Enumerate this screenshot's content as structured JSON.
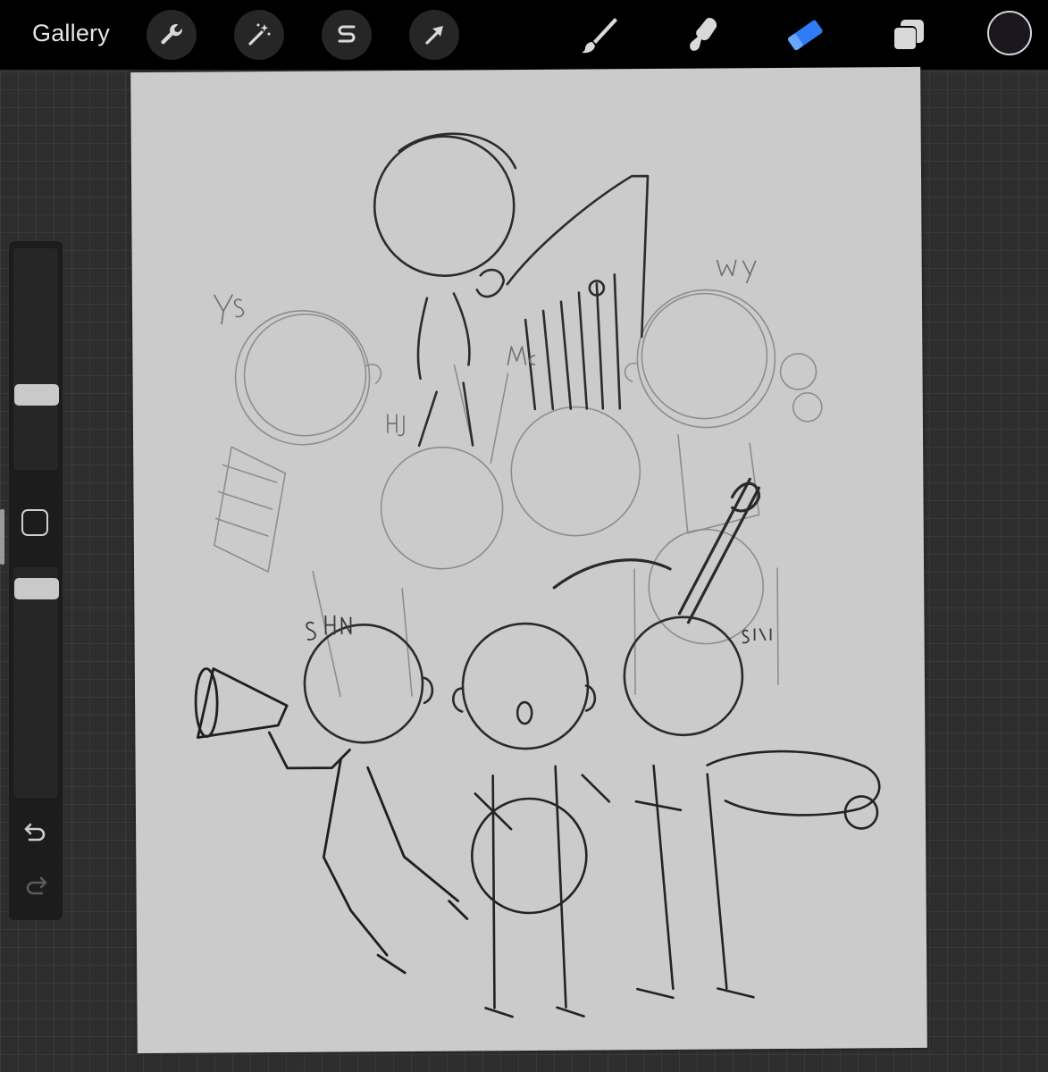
{
  "toolbar": {
    "gallery_label": "Gallery",
    "left_tools": [
      {
        "name": "actions",
        "icon": "wrench-icon"
      },
      {
        "name": "adjustments",
        "icon": "magic-wand-icon"
      },
      {
        "name": "selection",
        "icon": "selection-s-icon"
      },
      {
        "name": "transform",
        "icon": "arrow-cursor-icon"
      }
    ],
    "right_tools": [
      {
        "name": "brush",
        "icon": "brush-icon",
        "active": false
      },
      {
        "name": "smudge",
        "icon": "smudge-icon",
        "active": false
      },
      {
        "name": "eraser",
        "icon": "eraser-icon",
        "active": true
      },
      {
        "name": "layers",
        "icon": "layers-icon",
        "active": false
      }
    ],
    "current_color": "#1b1720",
    "active_tool_color": "#2f7df6"
  },
  "sidebar": {
    "brush_size_level": 0.7,
    "opacity_level": 0.85,
    "modify_button_icon": "square-icon",
    "undo_icon": "undo-icon",
    "redo_icon": "redo-icon"
  },
  "canvas": {
    "background": "#cbcbcb",
    "sketch_labels": [
      "YS",
      "WY",
      "HJ",
      "MG",
      "SHN",
      "SM"
    ]
  }
}
